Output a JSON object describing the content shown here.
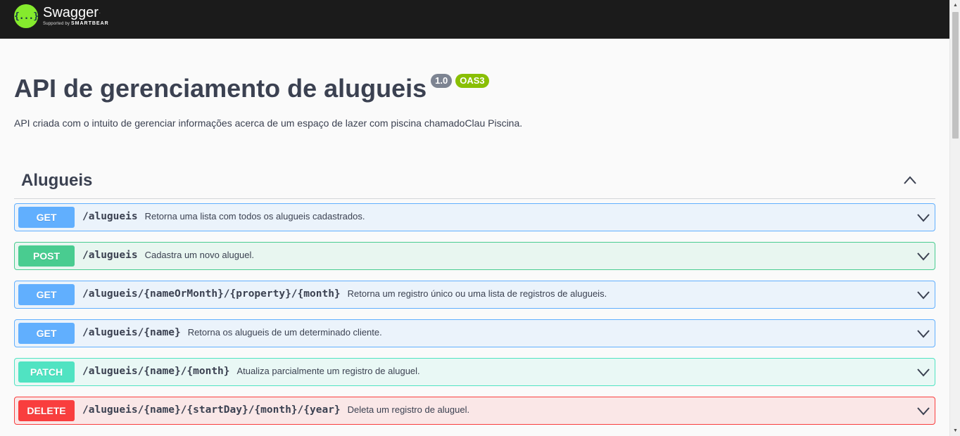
{
  "topbar": {
    "logo_icon": "swagger-braces-icon",
    "logo_glyph": "{...}",
    "logo_title": "Swagger",
    "logo_tm": ".",
    "logo_sub_prefix": "Supported by",
    "logo_sub_brand": "SMARTBEAR"
  },
  "info": {
    "title": "API de gerenciamento de alugueis",
    "version": "1.0",
    "oas_badge": "OAS3",
    "description": "API criada com o intuito de gerenciar informações acerca de um espaço de lazer com piscina chamadoClau Piscina."
  },
  "tag": {
    "name": "Alugueis",
    "toggle_icon": "chevron-up-icon"
  },
  "operations": [
    {
      "method": "GET",
      "path": "/alugueis",
      "summary": "Retorna uma lista com todos os alugueis cadastrados."
    },
    {
      "method": "POST",
      "path": "/alugueis",
      "summary": "Cadastra um novo aluguel."
    },
    {
      "method": "GET",
      "path": "/alugueis/{nameOrMonth}/{property}/{month}",
      "summary": "Retorna um registro único ou uma lista de registros de alugueis."
    },
    {
      "method": "GET",
      "path": "/alugueis/{name}",
      "summary": "Retorna os alugueis de um determinado cliente."
    },
    {
      "method": "PATCH",
      "path": "/alugueis/{name}/{month}",
      "summary": "Atualiza parcialmente um registro de aluguel."
    },
    {
      "method": "DELETE",
      "path": "/alugueis/{name}/{startDay}/{month}/{year}",
      "summary": "Deleta um registro de aluguel."
    }
  ],
  "colors": {
    "topbar": "#1b1b1b",
    "logo_green": "#85ea2d",
    "get": "#61affe",
    "post": "#49cc90",
    "patch": "#50e3c2",
    "delete": "#f93e3e",
    "version_badge": "#7d8492",
    "oas_badge": "#89bf04"
  }
}
